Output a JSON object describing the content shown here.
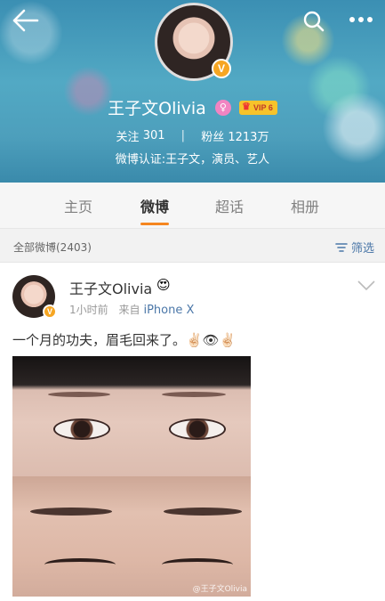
{
  "header": {
    "name": "王子文Olivia",
    "vip_label": "VIP 6",
    "gender_symbol": "♀",
    "verified_badge": "V",
    "follow_label": "关注",
    "follow_count": "301",
    "fans_label": "粉丝",
    "fans_count": "1213万",
    "verification": "微博认证:王子文，演员、艺人"
  },
  "tabs": [
    {
      "label": "主页"
    },
    {
      "label": "微博"
    },
    {
      "label": "超话"
    },
    {
      "label": "相册"
    }
  ],
  "active_tab": "微博",
  "filter_bar": {
    "count_label": "全部微博(2403)",
    "filter_label": "筛选"
  },
  "post": {
    "author": "王子文Olivia",
    "author_emoji": "😍",
    "time": "1小时前",
    "source_prefix": "来自",
    "source": "iPhone X",
    "text": "一个月的功夫，眉毛回来了。✌🏻👁✌🏻",
    "watermark": "@王子文Olivia"
  },
  "colors": {
    "accent": "#f5861f",
    "link": "#4b77a8",
    "badge": "#f6a623"
  },
  "icons": [
    "back-arrow-icon",
    "search-icon",
    "more-icon",
    "chevron-down-icon",
    "filter-icon"
  ]
}
